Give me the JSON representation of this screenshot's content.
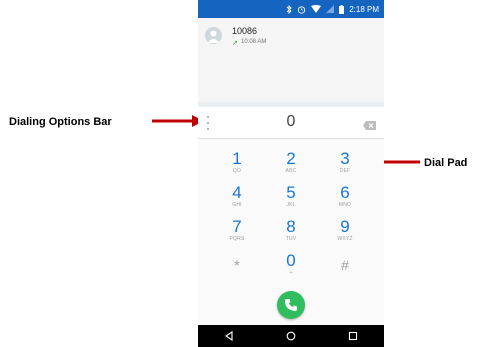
{
  "status_bar": {
    "time": "2:18 PM",
    "icons": [
      "bluetooth-icon",
      "alarm-icon",
      "wifi-icon",
      "signal-icon",
      "battery-icon"
    ],
    "color": "#1565c0"
  },
  "recent_call": {
    "number": "10086",
    "time": "10:08 AM",
    "direction": "outgoing"
  },
  "dial_bar": {
    "digits": "0"
  },
  "dialpad": {
    "accent": "#1976d2",
    "keys": [
      {
        "num": "1",
        "letters": "QO"
      },
      {
        "num": "2",
        "letters": "ABC"
      },
      {
        "num": "3",
        "letters": "DEF"
      },
      {
        "num": "4",
        "letters": "GHI"
      },
      {
        "num": "5",
        "letters": "JKL"
      },
      {
        "num": "6",
        "letters": "MNO"
      },
      {
        "num": "7",
        "letters": "PQRS"
      },
      {
        "num": "8",
        "letters": "TUV"
      },
      {
        "num": "9",
        "letters": "WXYZ"
      },
      {
        "num": "*",
        "letters": ""
      },
      {
        "num": "0",
        "letters": "+"
      },
      {
        "num": "#",
        "letters": ""
      }
    ]
  },
  "call_button_color": "#2fbd5f",
  "annotations": {
    "left": "Dialing Options Bar",
    "right": "Dial Pad",
    "arrow_color": "#c00000"
  }
}
